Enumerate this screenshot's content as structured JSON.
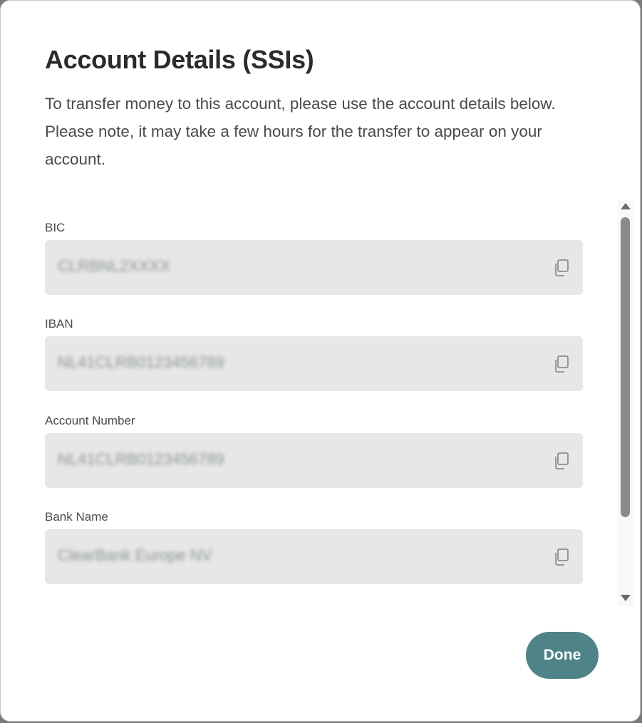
{
  "dialog": {
    "title": "Account Details (SSIs)",
    "description": "To transfer money to this account, please use the account details below. Please note, it may take a few hours for the transfer to appear on your account."
  },
  "fields": [
    {
      "label": "BIC",
      "value": "CLRBNL2XXXX",
      "icon": "copy-icon"
    },
    {
      "label": "IBAN",
      "value": "NL41CLRB0123456789",
      "icon": "copy-icon"
    },
    {
      "label": "Account Number",
      "value": "NL41CLRB0123456789",
      "icon": "copy-icon"
    },
    {
      "label": "Bank Name",
      "value": "ClearBank Europe NV",
      "icon": "copy-icon"
    }
  ],
  "actions": {
    "done_label": "Done"
  },
  "colors": {
    "primary_button": "#4e8387",
    "field_background": "#e6e7e7",
    "title_text": "#2b2b2b"
  }
}
